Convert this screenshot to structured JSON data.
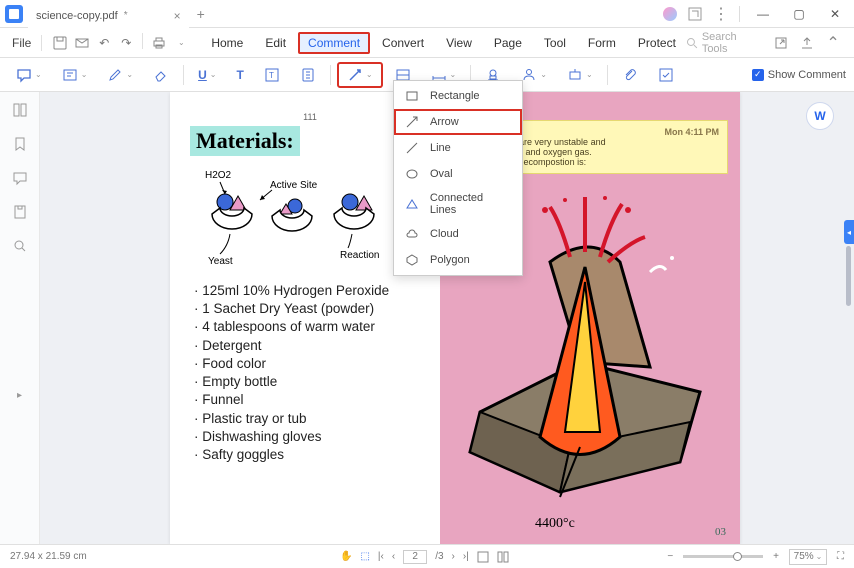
{
  "app": {
    "tab_title": "science-copy.pdf"
  },
  "menubar": {
    "file": "File",
    "items": [
      "Home",
      "Edit",
      "Comment",
      "Convert",
      "View",
      "Page",
      "Tool",
      "Form",
      "Protect"
    ],
    "active": "Comment",
    "search_placeholder": "Search Tools"
  },
  "toolbar": {
    "show_comment": "Show Comment"
  },
  "dropdown": {
    "items": [
      {
        "icon": "rectangle-icon",
        "label": "Rectangle"
      },
      {
        "icon": "arrow-icon",
        "label": "Arrow"
      },
      {
        "icon": "line-icon",
        "label": "Line"
      },
      {
        "icon": "oval-icon",
        "label": "Oval"
      },
      {
        "icon": "connected-lines-icon",
        "label": "Connected Lines"
      },
      {
        "icon": "cloud-icon",
        "label": "Cloud"
      },
      {
        "icon": "polygon-icon",
        "label": "Polygon"
      }
    ],
    "highlighted": "Arrow"
  },
  "document": {
    "page_number_top": "111",
    "title": "Materials:",
    "diagram_labels": {
      "h2o2": "H2O2",
      "active_site": "Active Site",
      "yeast": "Yeast",
      "reaction": "Reaction"
    },
    "bullets": [
      "125ml 10% Hydrogen Peroxide",
      "1 Sachet Dry Yeast (powder)",
      "4 tablespoons of warm water",
      "Detergent",
      "Food color",
      "Empty bottle",
      "Funnel",
      "Plastic tray or tub",
      "Dishwashing gloves",
      "Safty goggles"
    ],
    "sticky": {
      "timestamp": "Mon 4:11 PM",
      "line1": "xide molecules are very unstable and",
      "line2": "npose into water and oxygen gas.",
      "line3": "quation for this decompostion is:"
    },
    "volcano_temp": "4400°c",
    "page_number_br": "03"
  },
  "statusbar": {
    "dimensions": "27.94 x 21.59 cm",
    "page_current": "2",
    "page_total": "/3",
    "zoom": "75%"
  }
}
